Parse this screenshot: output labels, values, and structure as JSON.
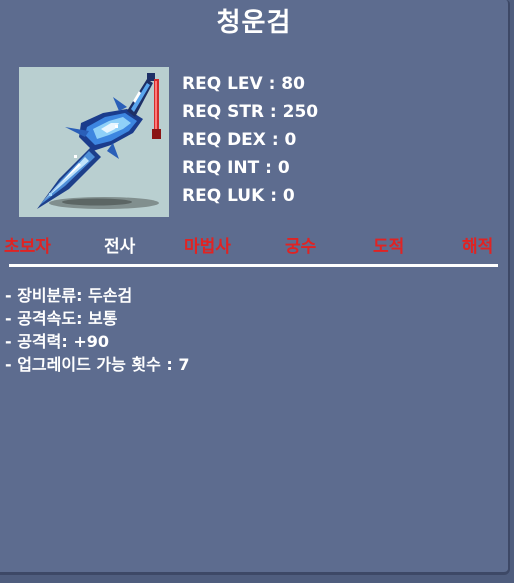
{
  "item": {
    "name": "청운검",
    "icon_name": "sword-icon"
  },
  "requirements": [
    "REQ LEV : 80",
    "REQ STR : 250",
    "REQ DEX : 0",
    "REQ INT : 0",
    "REQ LUK : 0"
  ],
  "jobs": [
    {
      "label": "초보자",
      "allowed": false
    },
    {
      "label": "전사",
      "allowed": true
    },
    {
      "label": "마법사",
      "allowed": false
    },
    {
      "label": "궁수",
      "allowed": false
    },
    {
      "label": "도적",
      "allowed": false
    },
    {
      "label": "해적",
      "allowed": false
    }
  ],
  "description": [
    "- 장비분류: 두손검",
    "- 공격속도: 보통",
    "- 공격력: +90",
    "- 업그레이드 가능 횟수 : 7"
  ],
  "colors": {
    "panel": "#5d6c8f",
    "allowed_job": "#ffffff",
    "disallowed_job": "#e02323",
    "icon_background": "#b9cfd0"
  }
}
